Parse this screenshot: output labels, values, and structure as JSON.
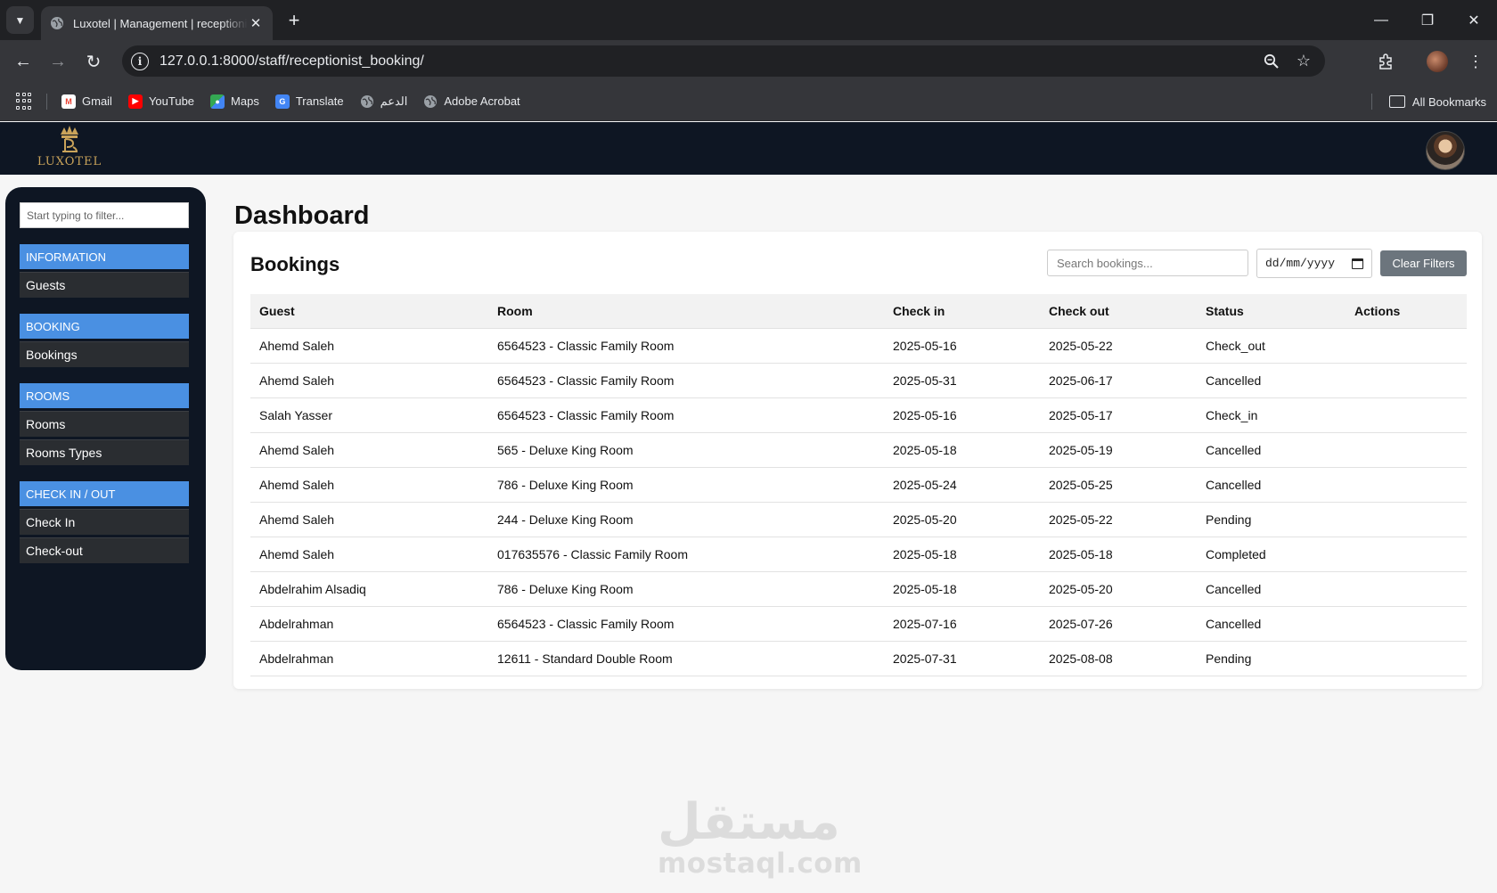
{
  "browser": {
    "tab_title": "Luxotel | Management | receptionist_booking",
    "url": "127.0.0.1:8000/staff/receptionist_booking/",
    "bookmarks": [
      {
        "label": "Gmail",
        "icon": "gmail-icon",
        "color": "#ea4335"
      },
      {
        "label": "YouTube",
        "icon": "youtube-icon",
        "color": "#ff0000"
      },
      {
        "label": "Maps",
        "icon": "maps-icon",
        "color": "#34a853"
      },
      {
        "label": "Translate",
        "icon": "translate-icon",
        "color": "#4285f4"
      },
      {
        "label": "الدعم",
        "icon": "globe-icon",
        "color": "#9aa0a6"
      },
      {
        "label": "Adobe Acrobat",
        "icon": "globe-icon",
        "color": "#9aa0a6"
      }
    ],
    "all_bookmarks": "All Bookmarks"
  },
  "header": {
    "logo_text": "LUXOTEL",
    "accent": "#c9a35a",
    "background": "#0e1623"
  },
  "sidebar": {
    "filter_placeholder": "Start typing to filter...",
    "groups": [
      {
        "heading": "INFORMATION",
        "items": [
          "Guests"
        ]
      },
      {
        "heading": "BOOKING",
        "items": [
          "Bookings"
        ]
      },
      {
        "heading": "ROOMS",
        "items": [
          "Rooms",
          "Rooms Types"
        ]
      },
      {
        "heading": "CHECK IN / OUT",
        "items": [
          "Check In",
          "Check-out"
        ]
      }
    ],
    "heading_color": "#4a90e2"
  },
  "main": {
    "page_title": "Dashboard",
    "card_title": "Bookings",
    "search_placeholder": "Search bookings...",
    "date_placeholder": "dd/mm/yyyy",
    "clear_label": "Clear Filters",
    "columns": [
      "Guest",
      "Room",
      "Check in",
      "Check out",
      "Status",
      "Actions"
    ],
    "rows": [
      [
        "Ahemd Saleh",
        "6564523 - Classic Family Room",
        "2025-05-16",
        "2025-05-22",
        "Check_out",
        ""
      ],
      [
        "Ahemd Saleh",
        "6564523 - Classic Family Room",
        "2025-05-31",
        "2025-06-17",
        "Cancelled",
        ""
      ],
      [
        "Salah Yasser",
        "6564523 - Classic Family Room",
        "2025-05-16",
        "2025-05-17",
        "Check_in",
        ""
      ],
      [
        "Ahemd Saleh",
        "565 - Deluxe King Room",
        "2025-05-18",
        "2025-05-19",
        "Cancelled",
        ""
      ],
      [
        "Ahemd Saleh",
        "786 - Deluxe King Room",
        "2025-05-24",
        "2025-05-25",
        "Cancelled",
        ""
      ],
      [
        "Ahemd Saleh",
        "244 - Deluxe King Room",
        "2025-05-20",
        "2025-05-22",
        "Pending",
        ""
      ],
      [
        "Ahemd Saleh",
        "017635576 - Classic Family Room",
        "2025-05-18",
        "2025-05-18",
        "Completed",
        ""
      ],
      [
        "Abdelrahim Alsadiq",
        "786 - Deluxe King Room",
        "2025-05-18",
        "2025-05-20",
        "Cancelled",
        ""
      ],
      [
        "Abdelrahman",
        "6564523 - Classic Family Room",
        "2025-07-16",
        "2025-07-26",
        "Cancelled",
        ""
      ],
      [
        "Abdelrahman",
        "12611 - Standard Double Room",
        "2025-07-31",
        "2025-08-08",
        "Pending",
        ""
      ]
    ]
  },
  "watermark": {
    "arabic": "مستقل",
    "latin": "mostaql.com"
  }
}
